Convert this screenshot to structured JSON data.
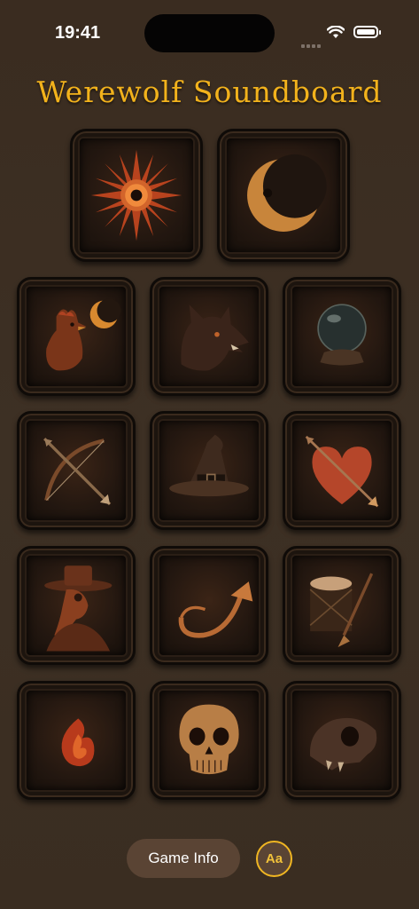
{
  "status_bar": {
    "time": "19:41",
    "wifi_icon": "wifi-icon",
    "battery_icon": "battery-icon"
  },
  "title": "Werewolf Soundboard",
  "accent_color": "#f2b21c",
  "tiles": [
    {
      "icon": "sun-icon"
    },
    {
      "icon": "crescent-moon-icon"
    },
    {
      "icon": "rooster-moon-icon"
    },
    {
      "icon": "werewolf-head-icon"
    },
    {
      "icon": "crystal-ball-icon"
    },
    {
      "icon": "bow-arrow-icon"
    },
    {
      "icon": "witch-hat-icon"
    },
    {
      "icon": "heart-arrow-icon"
    },
    {
      "icon": "plague-doctor-icon"
    },
    {
      "icon": "hunting-horn-icon"
    },
    {
      "icon": "drum-spear-icon"
    },
    {
      "icon": "flame-icon"
    },
    {
      "icon": "human-skull-icon"
    },
    {
      "icon": "animal-skull-icon"
    }
  ],
  "footer": {
    "game_info_label": "Game Info",
    "font_toggle_label": "Aa"
  }
}
